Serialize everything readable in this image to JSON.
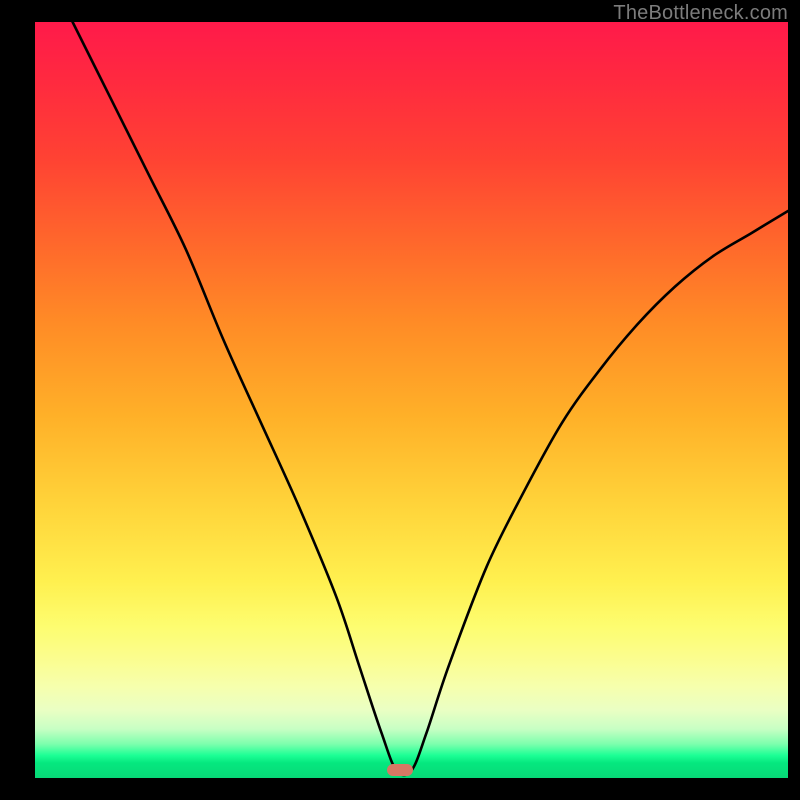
{
  "watermark": "TheBottleneck.com",
  "colors": {
    "curve_stroke": "#000000",
    "marker_fill": "#d77864",
    "frame_bg": "#000000"
  },
  "chart_data": {
    "type": "line",
    "title": "",
    "xlabel": "",
    "ylabel": "",
    "xlim": [
      0,
      100
    ],
    "ylim": [
      0,
      100
    ],
    "marker": {
      "x_percent": 48.5,
      "y_percent": 99.0
    },
    "series": [
      {
        "name": "bottleneck-curve",
        "x_percent": [
          5,
          10,
          15,
          20,
          25,
          30,
          35,
          40,
          43,
          46,
          48,
          50,
          52,
          55,
          60,
          65,
          70,
          75,
          80,
          85,
          90,
          95,
          100
        ],
        "y_percent": [
          100,
          90,
          80,
          70,
          58,
          47,
          36,
          24,
          15,
          6,
          1,
          1,
          6,
          15,
          28,
          38,
          47,
          54,
          60,
          65,
          69,
          72,
          75
        ]
      }
    ]
  }
}
